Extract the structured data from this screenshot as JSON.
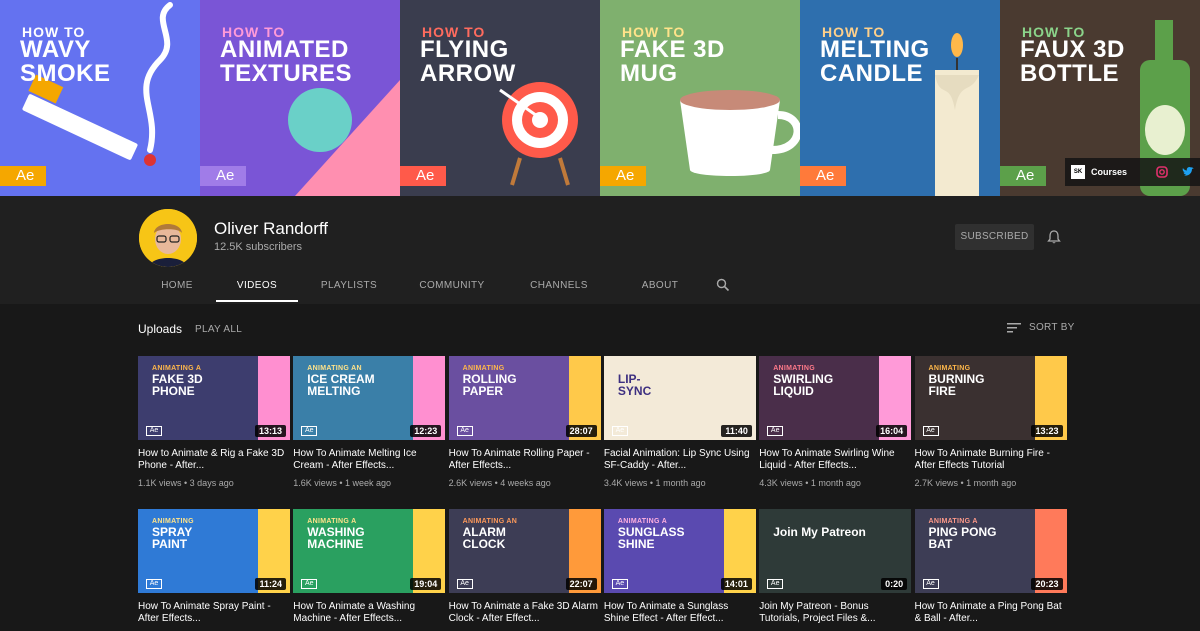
{
  "banner": {
    "tiles": [
      {
        "how": "HOW TO",
        "title": "WAVY\nSMOKE",
        "ae": "Ae",
        "bg": "#6472f0",
        "how_color": "#ffffff",
        "title_color": "#ffffff",
        "ae_bg": "#f5a700"
      },
      {
        "how": "HOW TO",
        "title": "ANIMATED\nTEXTURES",
        "ae": "Ae",
        "bg": "#7a55d6",
        "how_color": "#ff9ad8",
        "title_color": "#ffffff",
        "ae_bg": "#a07ce8"
      },
      {
        "how": "HOW TO",
        "title": "FLYING\nARROW",
        "ae": "Ae",
        "bg": "#3a3d4e",
        "how_color": "#ff6b5e",
        "title_color": "#ffffff",
        "ae_bg": "#ff5a4a"
      },
      {
        "how": "HOW TO",
        "title": "FAKE 3D\nMUG",
        "ae": "Ae",
        "bg": "#7fb06e",
        "how_color": "#ffe38a",
        "title_color": "#ffffff",
        "ae_bg": "#f5a700"
      },
      {
        "how": "HOW TO",
        "title": "MELTING\nCANDLE",
        "ae": "Ae",
        "bg": "#2e6fae",
        "how_color": "#ffd08a",
        "title_color": "#ffffff",
        "ae_bg": "#ff7a3a"
      },
      {
        "how": "HOW TO",
        "title": "FAUX 3D\nBOTTLE",
        "ae": "Ae",
        "bg": "#4a3a30",
        "how_color": "#8bd48a",
        "title_color": "#ffffff",
        "ae_bg": "#5ca04a"
      }
    ],
    "social": {
      "sk": "SK",
      "courses": "Courses"
    }
  },
  "channel": {
    "name": "Oliver Randorff",
    "subscribers": "12.5K subscribers",
    "subscribed_label": "SUBSCRIBED"
  },
  "tabs": [
    "HOME",
    "VIDEOS",
    "PLAYLISTS",
    "COMMUNITY",
    "CHANNELS",
    "ABOUT"
  ],
  "active_tab": "VIDEOS",
  "uploads": {
    "label": "Uploads",
    "play_all": "PLAY ALL",
    "sort_by": "SORT BY"
  },
  "videos": [
    {
      "kicker": "ANIMATING A",
      "headline": "FAKE 3D\nPHONE",
      "duration": "13:13",
      "title": "How to Animate & Rig a Fake 3D Phone - After...",
      "meta": "1.1K views • 3 days ago",
      "bg": "#3d3d6e",
      "kicker_color": "#ffb84a",
      "stripe": "#ff8fd0"
    },
    {
      "kicker": "ANIMATING AN",
      "headline": "ICE CREAM\nMELTING",
      "duration": "12:23",
      "title": "How To Animate Melting Ice Cream - After Effects...",
      "meta": "1.6K views • 1 week ago",
      "bg": "#3a7fa8",
      "kicker_color": "#ffe38a",
      "stripe": "#ff8fd0"
    },
    {
      "kicker": "ANIMATING",
      "headline": "ROLLING\nPAPER",
      "duration": "28:07",
      "title": "How To Animate Rolling Paper - After Effects...",
      "meta": "2.6K views • 4 weeks ago",
      "bg": "#6a4fa0",
      "kicker_color": "#ffb84a",
      "stripe": "#ffc94a"
    },
    {
      "kicker": "",
      "headline": "LIP-\nSYNC",
      "duration": "11:40",
      "title": "Facial Animation: Lip Sync Using SF-Caddy - After...",
      "meta": "3.4K views • 1 month ago",
      "bg": "#f3ead8",
      "kicker_color": "#3d2f80",
      "stripe": "#f3ead8"
    },
    {
      "kicker": "ANIMATING",
      "headline": "SWIRLING\nLIQUID",
      "duration": "16:04",
      "title": "How To Animate Swirling Wine Liquid - After Effects...",
      "meta": "4.3K views • 1 month ago",
      "bg": "#4a2e4a",
      "kicker_color": "#ff7a8a",
      "stripe": "#ff9ad8"
    },
    {
      "kicker": "ANIMATING",
      "headline": "BURNING\nFIRE",
      "duration": "13:23",
      "title": "How To Animate Burning Fire - After Effects Tutorial",
      "meta": "2.7K views • 1 month ago",
      "bg": "#3a3030",
      "kicker_color": "#ffb84a",
      "stripe": "#ffc94a"
    },
    {
      "kicker": "ANIMATING",
      "headline": "SPRAY\nPAINT",
      "duration": "11:24",
      "title": "How To Animate Spray Paint - After Effects...",
      "meta": "",
      "bg": "#2f7ad6",
      "kicker_color": "#ffe38a",
      "stripe": "#ffd24a"
    },
    {
      "kicker": "ANIMATING A",
      "headline": "WASHING\nMACHINE",
      "duration": "19:04",
      "title": "How To Animate a Washing Machine - After Effects...",
      "meta": "",
      "bg": "#2aa060",
      "kicker_color": "#ffe38a",
      "stripe": "#ffd24a"
    },
    {
      "kicker": "ANIMATING AN",
      "headline": "ALARM\nCLOCK",
      "duration": "22:07",
      "title": "How To Animate a Fake 3D Alarm Clock - After Effect...",
      "meta": "",
      "bg": "#3d3d55",
      "kicker_color": "#ff9a5a",
      "stripe": "#ff9a3a"
    },
    {
      "kicker": "ANIMATING A",
      "headline": "SUNGLASS\nSHINE",
      "duration": "14:01",
      "title": "How To Animate a Sunglass Shine Effect - After Effect...",
      "meta": "",
      "bg": "#5a4ab0",
      "kicker_color": "#ffb0e0",
      "stripe": "#ffd24a"
    },
    {
      "kicker": "",
      "headline": "Join My Patreon",
      "duration": "0:20",
      "title": "Join My Patreon - Bonus Tutorials, Project Files &...",
      "meta": "",
      "bg": "#2e3a38",
      "kicker_color": "#ffffff",
      "stripe": "#2e3a38"
    },
    {
      "kicker": "ANIMATING A",
      "headline": "PING PONG\nBAT",
      "duration": "20:23",
      "title": "How To Animate a Ping Pong Bat & Ball - After...",
      "meta": "",
      "bg": "#3d3d55",
      "kicker_color": "#ff9a8a",
      "stripe": "#ff7a5a"
    }
  ],
  "ae_label": "Ae"
}
